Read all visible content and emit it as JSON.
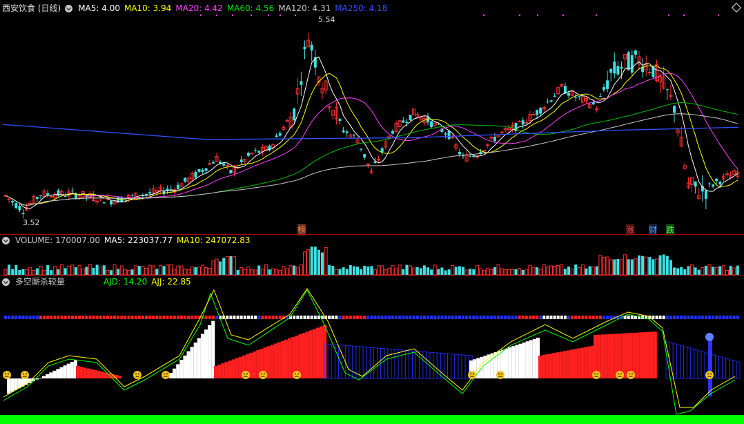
{
  "main": {
    "stock_name": "西安饮食 (日线)",
    "ma_items": [
      {
        "label": "MA5: 4.00",
        "color": "#ffffff"
      },
      {
        "label": "MA10: 3.94",
        "color": "#ffff00"
      },
      {
        "label": "MA20: 4.42",
        "color": "#ff40ff"
      },
      {
        "label": "MA60: 4.56",
        "color": "#00e000"
      },
      {
        "label": "MA120: 4.31",
        "color": "#c8c8c8"
      },
      {
        "label": "MA250: 4.18",
        "color": "#3050ff"
      }
    ],
    "high_label": "5.54",
    "low_label": "3.52",
    "events": [
      {
        "text": "榜",
        "color": "#ff8040",
        "bg": "#603020"
      },
      {
        "text": "涨",
        "color": "#ff4040",
        "bg": "#401010"
      },
      {
        "text": "财",
        "color": "#40a0ff",
        "bg": "#102040"
      },
      {
        "text": "跌",
        "color": "#40ff40",
        "bg": "#104010"
      }
    ]
  },
  "volume": {
    "title": "VOLUME: 170007.00",
    "ma5": "MA5: 223037.77",
    "ma10": "MA10: 247072.83",
    "colors": {
      "title": "#c8c8c8",
      "ma5": "#ffffff",
      "ma10": "#ffff00"
    }
  },
  "indicator": {
    "name": "多空厮杀较量",
    "ajd": "AJD: 14.20",
    "ajj": "AJJ: 22.85",
    "colors": {
      "ajd": "#00ff00",
      "ajj": "#ffff00"
    }
  },
  "colors": {
    "up": "#ff3030",
    "down": "#40e0e0",
    "border": "#b00000",
    "bottom_bar": "#00ff00"
  }
}
